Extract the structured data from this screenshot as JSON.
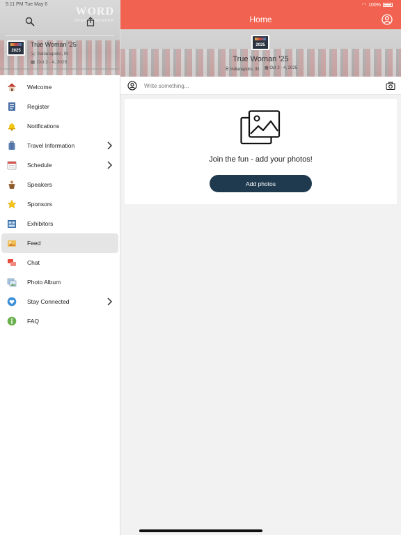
{
  "status_bar": {
    "time": "5:11 PM   Tue May 6",
    "battery": "100%"
  },
  "sidebar": {
    "watermark": "WORD",
    "watermark_sub": "BREATH WONDER",
    "event": {
      "thumb_text": "2025",
      "title": "True Woman '25",
      "location": "Indianapolis, IN",
      "dates": "Oct 2 - 4, 2025"
    },
    "items": [
      {
        "label": "Welcome",
        "icon": "house-icon",
        "chevron": false
      },
      {
        "label": "Register",
        "icon": "register-icon",
        "chevron": false
      },
      {
        "label": "Notifications",
        "icon": "bell-icon",
        "chevron": false
      },
      {
        "label": "Travel Information",
        "icon": "suitcase-icon",
        "chevron": true
      },
      {
        "label": "Schedule",
        "icon": "calendar-icon",
        "chevron": true
      },
      {
        "label": "Speakers",
        "icon": "podium-icon",
        "chevron": false
      },
      {
        "label": "Sponsors",
        "icon": "star-icon",
        "chevron": false
      },
      {
        "label": "Exhibitors",
        "icon": "booth-icon",
        "chevron": false
      },
      {
        "label": "Feed",
        "icon": "feed-icon",
        "chevron": false,
        "active": true
      },
      {
        "label": "Chat",
        "icon": "chat-icon",
        "chevron": false
      },
      {
        "label": "Photo Album",
        "icon": "photo-album-icon",
        "chevron": false
      },
      {
        "label": "Stay Connected",
        "icon": "heart-icon",
        "chevron": true
      },
      {
        "label": "FAQ",
        "icon": "info-icon",
        "chevron": false
      }
    ]
  },
  "header": {
    "title": "Home",
    "accent_color": "#f26250"
  },
  "banner": {
    "thumb_text": "2025",
    "title": "True Woman '25",
    "location": "Indianapolis, IN",
    "dates": "Oct 2 - 4, 2025"
  },
  "composer": {
    "placeholder": "Write something..."
  },
  "empty_state": {
    "prompt": "Join the fun - add your photos!",
    "button_label": "Add photos",
    "button_color": "#1f3a4f"
  }
}
